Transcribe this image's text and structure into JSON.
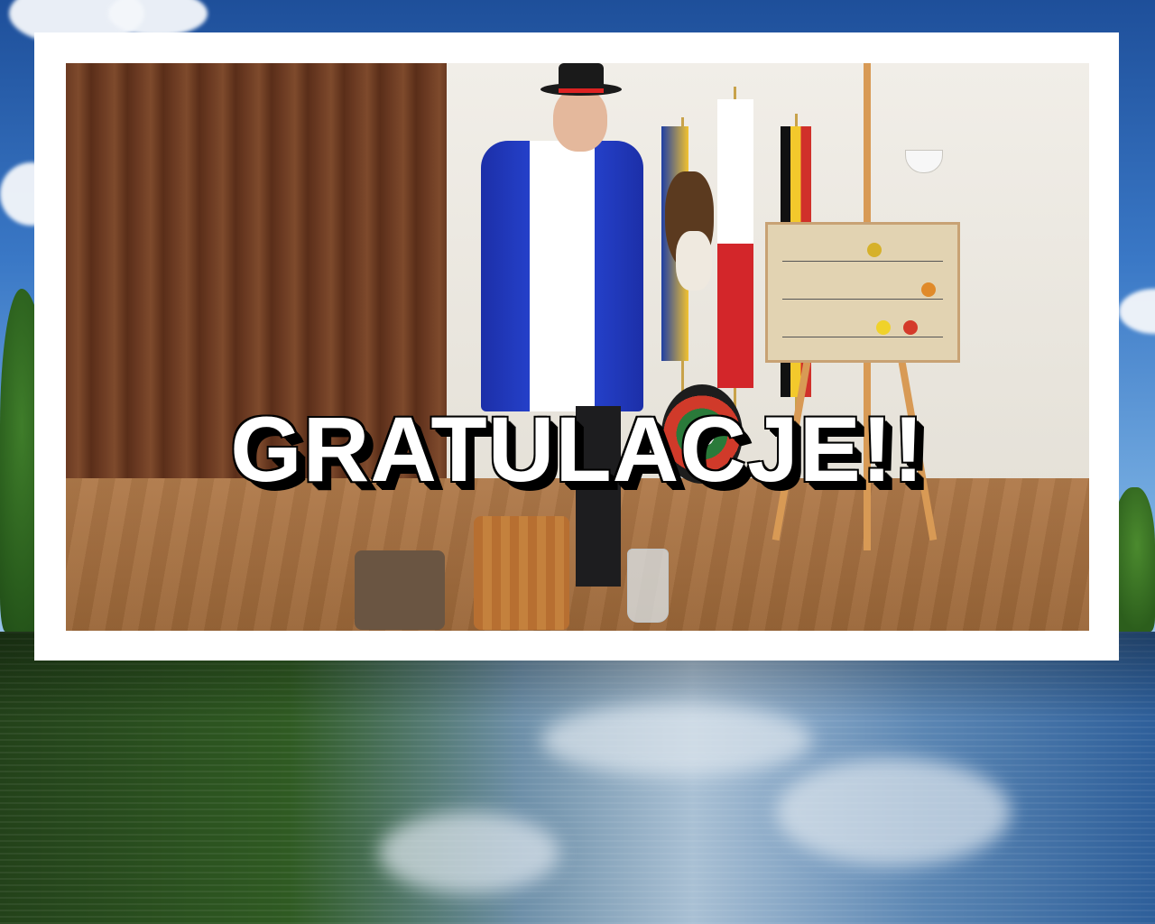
{
  "headline": {
    "text": "GRATULACJE!!"
  },
  "photo": {
    "subject": "performer-in-folk-costume",
    "frame_color": "#ffffff"
  },
  "background": {
    "sky_color": "#3a78c6",
    "water_color": "#2f5a22"
  }
}
